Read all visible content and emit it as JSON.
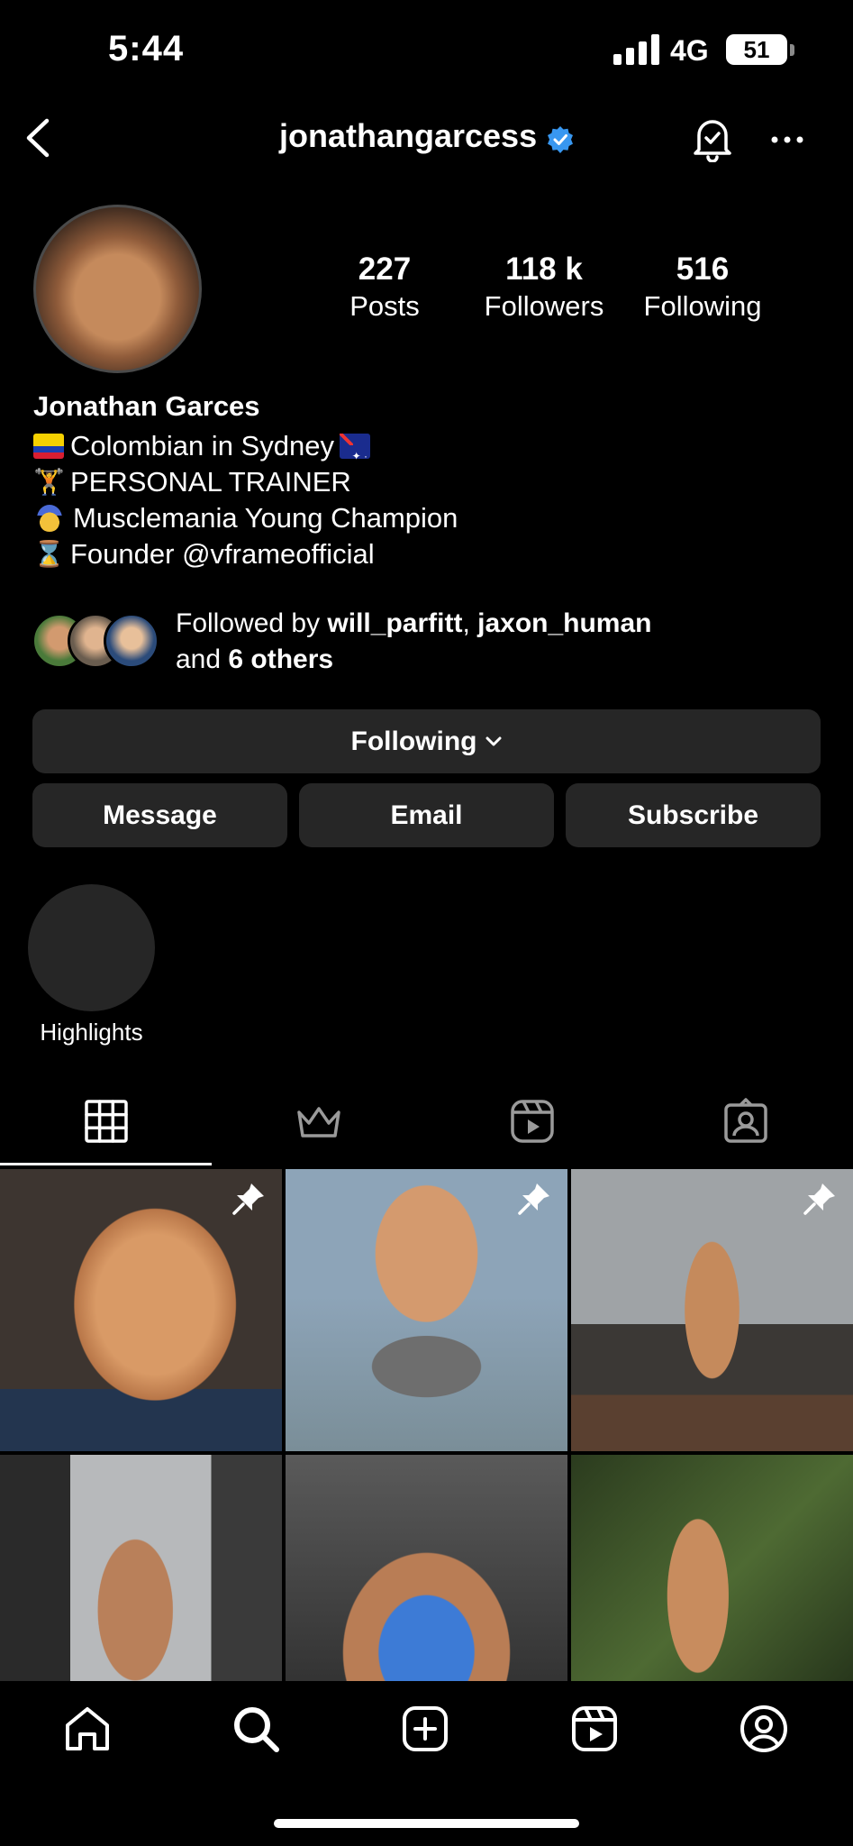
{
  "status_bar": {
    "time": "5:44",
    "network": "4G",
    "battery": "51"
  },
  "header": {
    "username": "jonathangarcess",
    "verified": true
  },
  "profile": {
    "stats": [
      {
        "value": "227",
        "label": "Posts"
      },
      {
        "value": "118 k",
        "label": "Followers"
      },
      {
        "value": "516",
        "label": "Following"
      }
    ],
    "full_name": "Jonathan Garces",
    "bio": [
      {
        "emoji": "colombia-flag",
        "text": "Colombian in Sydney",
        "trailing_emoji": "australia-flag"
      },
      {
        "emoji": "weight-lifter",
        "text": "PERSONAL TRAINER"
      },
      {
        "emoji": "gold-medal",
        "text": "Musclemania Young Champion"
      },
      {
        "emoji": "hourglass",
        "text": "Founder @vframeofficial"
      }
    ]
  },
  "followed_by": {
    "prefix": "Followed by ",
    "user1": "will_parfitt",
    "separator": ", ",
    "user2": "jaxon_human",
    "and": "and ",
    "others": "6 others"
  },
  "actions": {
    "following": "Following",
    "message": "Message",
    "email": "Email",
    "subscribe": "Subscribe"
  },
  "highlights": {
    "label": "Highlights"
  },
  "tabs": [
    {
      "name": "grid-icon",
      "active": true
    },
    {
      "name": "crown-icon",
      "active": false
    },
    {
      "name": "reels-icon",
      "active": false
    },
    {
      "name": "tagged-icon",
      "active": false
    }
  ],
  "posts": [
    {
      "pinned": true
    },
    {
      "pinned": true
    },
    {
      "pinned": true
    },
    {
      "pinned": false
    },
    {
      "pinned": false
    },
    {
      "pinned": false
    }
  ],
  "bottom_nav": [
    "home-icon",
    "search-icon",
    "create-icon",
    "reels-icon",
    "profile-icon"
  ],
  "colors": {
    "background": "#000000",
    "button": "#262626",
    "verified": "#3897f0"
  }
}
